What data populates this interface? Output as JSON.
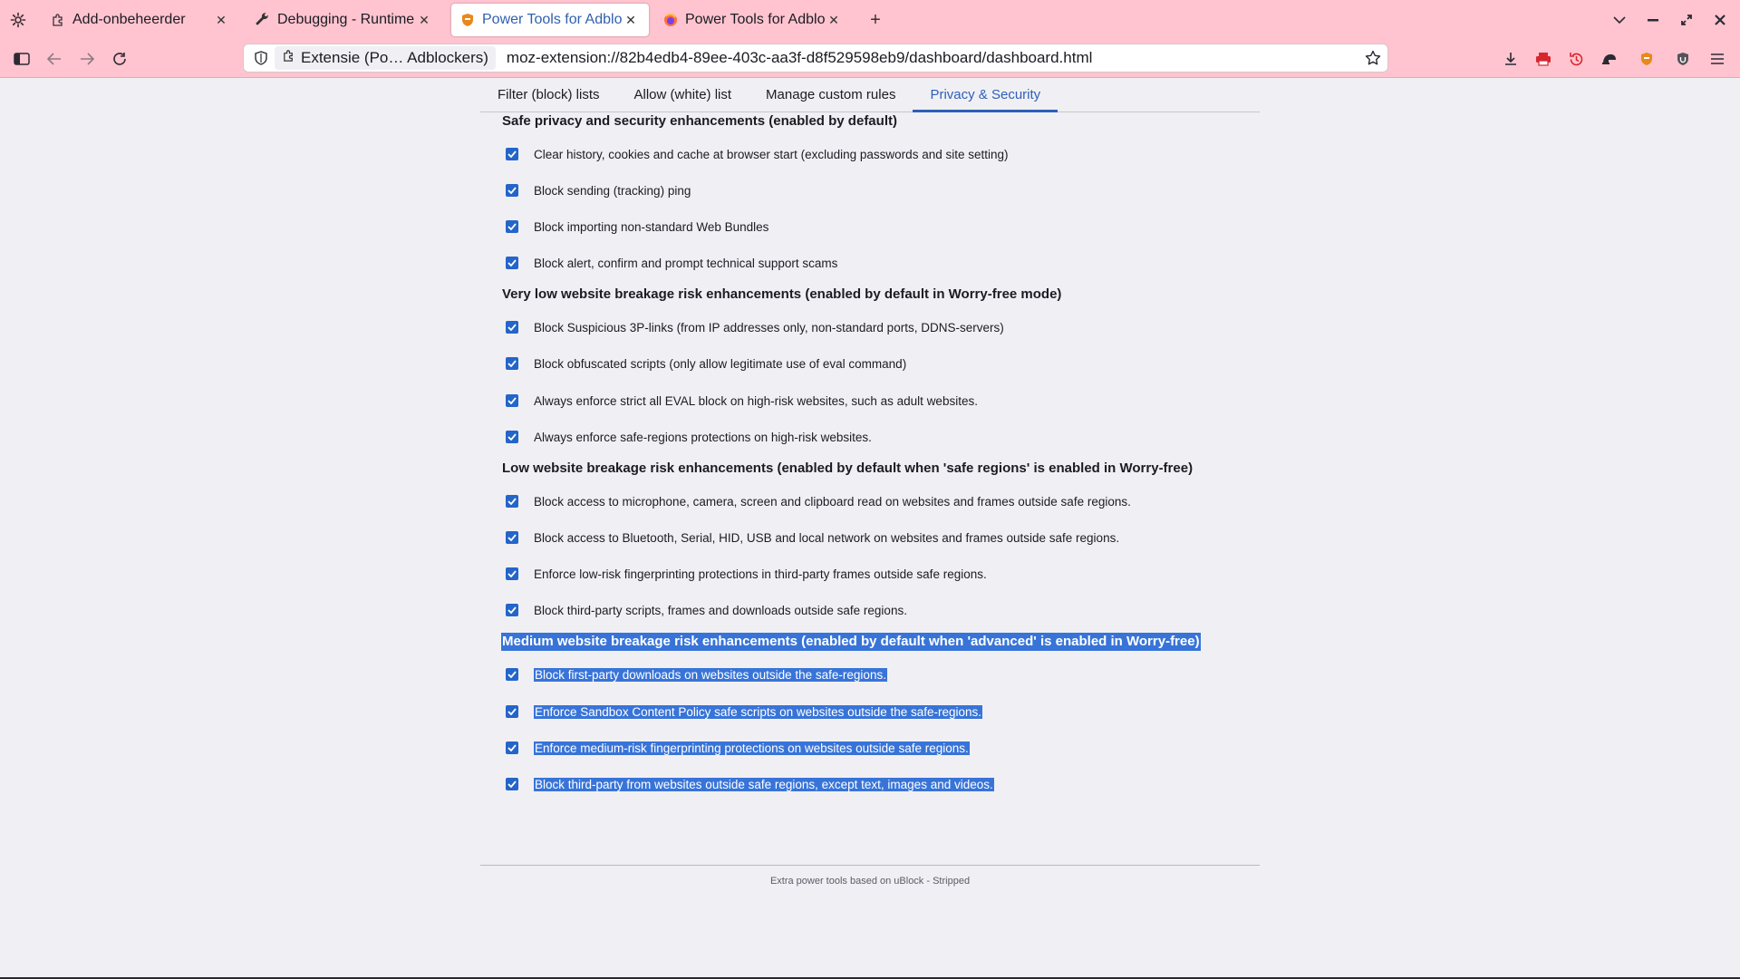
{
  "tabs": [
    {
      "title": "Add-onbeheerder",
      "icon": "puzzle-icon",
      "active": false
    },
    {
      "title": "Debugging - Runtime / ",
      "icon": "wrench-icon",
      "active": false
    },
    {
      "title": "Power Tools for Adbloc",
      "icon": "shield-extension-icon",
      "active": true
    },
    {
      "title": "Power Tools for Adbloc",
      "icon": "firefox-icon",
      "active": false
    }
  ],
  "navbar": {
    "identity_label": "Extensie (Po… Adblockers)",
    "url": "moz-extension://82b4edb4-89ee-403c-aa3f-d8f529598eb9/dashboard/dashboard.html"
  },
  "dashboard": {
    "tabs": [
      "Filter (block) lists",
      "Allow (white) list",
      "Manage custom rules",
      "Privacy & Security"
    ],
    "active_tab": "Privacy & Security",
    "sections": [
      {
        "heading": "Safe privacy and security enhancements (enabled by default)",
        "selected": false,
        "options": [
          {
            "label": "Clear history, cookies and cache at browser start (excluding passwords and site setting)",
            "checked": true
          },
          {
            "label": "Block sending (tracking) ping",
            "checked": true
          },
          {
            "label": "Block importing non-standard Web Bundles",
            "checked": true
          },
          {
            "label": "Block alert, confirm and prompt technical support scams",
            "checked": true
          }
        ]
      },
      {
        "heading": "Very low website breakage risk enhancements (enabled by default in Worry-free mode)",
        "selected": false,
        "options": [
          {
            "label": "Block Suspicious 3P-links (from IP addresses only, non-standard ports, DDNS-servers)",
            "checked": true
          },
          {
            "label": "Block obfuscated scripts (only allow legitimate use of eval command)",
            "checked": true
          },
          {
            "label": "Always enforce strict all EVAL block on high-risk websites, such as adult websites.",
            "checked": true
          },
          {
            "label": "Always enforce safe-regions protections on high-risk websites.",
            "checked": true
          }
        ]
      },
      {
        "heading": "Low website breakage risk enhancements (enabled by default when 'safe regions' is enabled in Worry-free)",
        "selected": false,
        "options": [
          {
            "label": "Block access to microphone, camera, screen and clipboard read on websites and frames outside safe regions.",
            "checked": true
          },
          {
            "label": "Block access to Bluetooth, Serial, HID, USB and local network on websites and frames outside safe regions.",
            "checked": true
          },
          {
            "label": "Enforce low-risk fingerprinting protections in third-party frames outside safe regions.",
            "checked": true
          },
          {
            "label": "Block third-party scripts, frames and downloads outside safe regions.",
            "checked": true
          }
        ]
      },
      {
        "heading": "Medium website breakage risk enhancements (enabled by default when 'advanced' is enabled in Worry-free)",
        "selected": true,
        "options": [
          {
            "label": "Block first-party downloads on websites outside the safe-regions.",
            "checked": true
          },
          {
            "label": "Enforce Sandbox Content Policy safe scripts on websites outside the safe-regions.",
            "checked": true
          },
          {
            "label": "Enforce medium-risk fingerprinting protections on websites outside safe regions.",
            "checked": true
          },
          {
            "label": "Block third-party from websites outside safe regions, except text, images and videos.",
            "checked": true
          }
        ]
      }
    ],
    "footer": "Extra power tools based on uBlock - Stripped"
  },
  "colors": {
    "toolbar_bg": "#ffc4d0",
    "accent": "#2f5fb8",
    "checkbox": "#2465c9",
    "selection": "#3874d8"
  }
}
